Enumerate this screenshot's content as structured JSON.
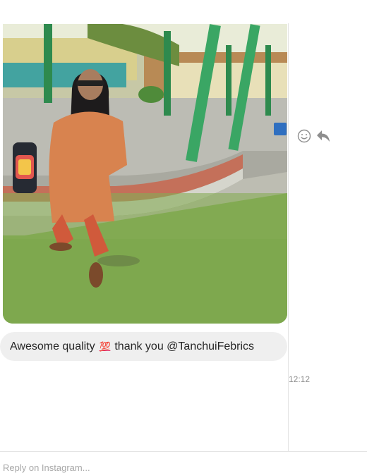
{
  "message_photo": {
    "icon": "photo-thumbnail"
  },
  "message_actions": {
    "react_icon": "smiley-icon",
    "reply_icon": "reply-arrow-icon"
  },
  "message_text": {
    "before_emoji": "Awesome quality",
    "emoji": "💯",
    "after_emoji": "thank you @TanchuiFebrics"
  },
  "timestamp": "12:12",
  "composer": {
    "placeholder": "Reply on Instagram..."
  },
  "colors": {
    "bubble_bg": "#efefef",
    "text": "#262626",
    "meta_text": "#8e8e8e",
    "divider": "#e4e4e4"
  }
}
